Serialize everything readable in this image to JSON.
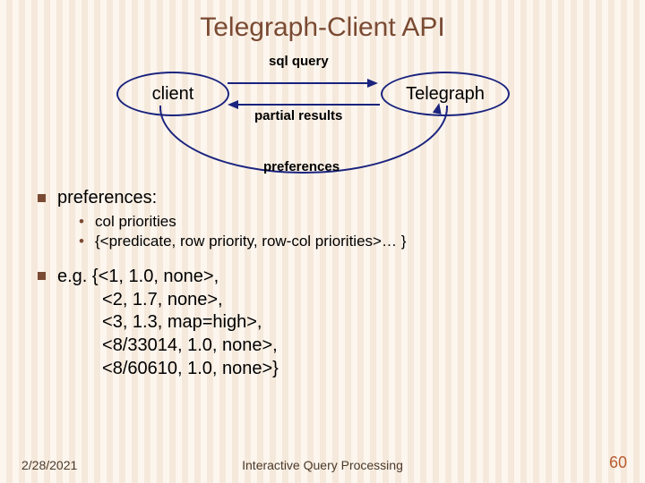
{
  "title": "Telegraph-Client API",
  "diagram": {
    "client_label": "client",
    "telegraph_label": "Telegraph",
    "arrow_top": "sql query",
    "arrow_mid": "partial results",
    "arrow_bottom": "preferences"
  },
  "bullets": {
    "pref_heading": "preferences:",
    "pref_sub1": "col priorities",
    "pref_sub2": "{<predicate, row priority, row-col priorities>… }",
    "eg_heading": "e.g. ",
    "eg_lines": "{<1, 1.0, none>,\n         <2, 1.7, none>,\n         <3, 1.3, map=high>,\n         <8/33014, 1.0, none>,\n         <8/60610, 1.0, none>}"
  },
  "footer": {
    "date": "2/28/2021",
    "caption": "Interactive Query Processing",
    "page": "60"
  }
}
